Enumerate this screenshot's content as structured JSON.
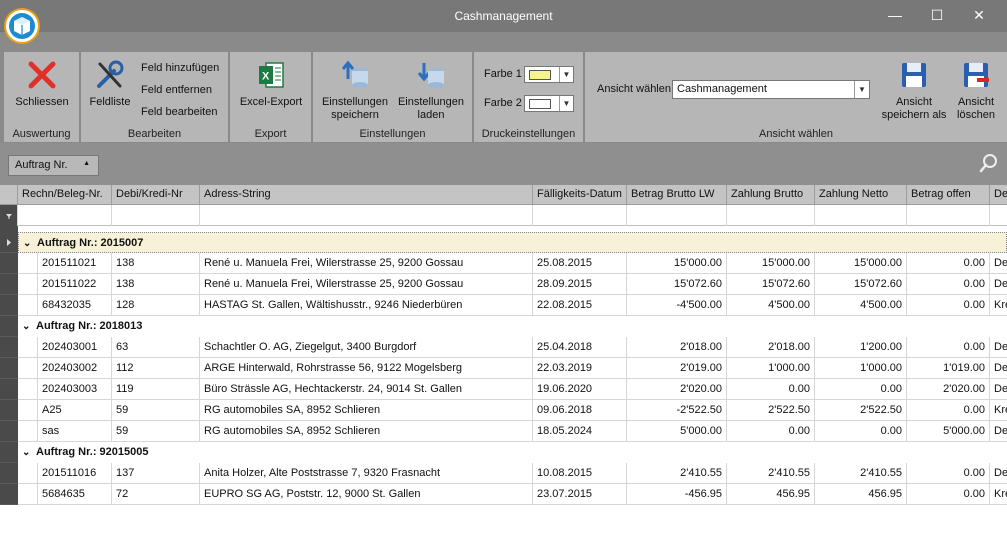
{
  "window": {
    "title": "Cashmanagement",
    "minimize": "—",
    "maximize": "☐",
    "close": "✕"
  },
  "ribbon": {
    "auswertung": {
      "label": "Auswertung",
      "close_label": "Schliessen"
    },
    "bearbeiten": {
      "label": "Bearbeiten",
      "feldliste_label": "Feldliste",
      "add_field": "Feld hinzufügen",
      "remove_field": "Feld entfernen",
      "edit_field": "Feld bearbeiten"
    },
    "export": {
      "label": "Export",
      "excel_label": "Excel-Export"
    },
    "einstellungen": {
      "label": "Einstellungen",
      "save_line1": "Einstellungen",
      "save_line2": "speichern",
      "load_line1": "Einstellungen",
      "load_line2": "laden"
    },
    "druck": {
      "label": "Druckeinstellungen",
      "farbe1": "Farbe 1",
      "farbe2": "Farbe 2",
      "farbe1_color": "#f5f58c",
      "farbe2_color": "#ffffff"
    },
    "ansicht": {
      "label": "Ansicht wählen",
      "select_label": "Ansicht wählen",
      "select_value": "Cashmanagement",
      "save_line1": "Ansicht",
      "save_line2": "speichern als",
      "delete_line1": "Ansicht",
      "delete_line2": "löschen"
    }
  },
  "grouppanel": {
    "chip_label": "Auftrag Nr."
  },
  "grid": {
    "columns": [
      "Rechn/Beleg-Nr.",
      "Debi/Kredi-Nr",
      "Adress-String",
      "Fälligkeits-Datum",
      "Betrag Brutto LW",
      "Zahlung Brutto",
      "Zahlung Netto",
      "Betrag offen",
      "De"
    ],
    "groups": [
      {
        "label": "Auftrag Nr.: 2015007",
        "rows": [
          [
            "201511021",
            "138",
            "René u. Manuela Frei, Wilerstrasse 25, 9200 Gossau",
            "25.08.2015",
            "15'000.00",
            "15'000.00",
            "15'000.00",
            "0.00",
            "De"
          ],
          [
            "201511022",
            "138",
            "René u. Manuela Frei, Wilerstrasse 25, 9200 Gossau",
            "28.09.2015",
            "15'072.60",
            "15'072.60",
            "15'072.60",
            "0.00",
            "De"
          ],
          [
            "68432035",
            "128",
            "HASTAG St. Gallen, Wältishusstr., 9246 Niederbüren",
            "22.08.2015",
            "-4'500.00",
            "4'500.00",
            "4'500.00",
            "0.00",
            "Kre"
          ]
        ]
      },
      {
        "label": "Auftrag Nr.: 2018013",
        "rows": [
          [
            "202403001",
            "63",
            "Schachtler O. AG, Ziegelgut, 3400 Burgdorf",
            "25.04.2018",
            "2'018.00",
            "2'018.00",
            "1'200.00",
            "0.00",
            "De"
          ],
          [
            "202403002",
            "112",
            "ARGE Hinterwald, Rohrstrasse 56, 9122 Mogelsberg",
            "22.03.2019",
            "2'019.00",
            "1'000.00",
            "1'000.00",
            "1'019.00",
            "De"
          ],
          [
            "202403003",
            "119",
            "Büro Strässle AG, Hechtackerstr. 24, 9014 St. Gallen",
            "19.06.2020",
            "2'020.00",
            "0.00",
            "0.00",
            "2'020.00",
            "De"
          ],
          [
            "A25",
            "59",
            "RG automobiles SA, 8952 Schlieren",
            "09.06.2018",
            "-2'522.50",
            "2'522.50",
            "2'522.50",
            "0.00",
            "Kre"
          ],
          [
            "sas",
            "59",
            "RG automobiles SA, 8952 Schlieren",
            "18.05.2024",
            "5'000.00",
            "0.00",
            "0.00",
            "5'000.00",
            "De"
          ]
        ]
      },
      {
        "label": "Auftrag Nr.: 92015005",
        "rows": [
          [
            "201511016",
            "137",
            "Anita Holzer, Alte Poststrasse 7, 9320 Frasnacht",
            "10.08.2015",
            "2'410.55",
            "2'410.55",
            "2'410.55",
            "0.00",
            "De"
          ],
          [
            "5684635",
            "72",
            "EUPRO SG AG, Poststr. 12, 9000 St. Gallen",
            "23.07.2015",
            "-456.95",
            "456.95",
            "456.95",
            "0.00",
            "Kre"
          ]
        ]
      }
    ]
  }
}
